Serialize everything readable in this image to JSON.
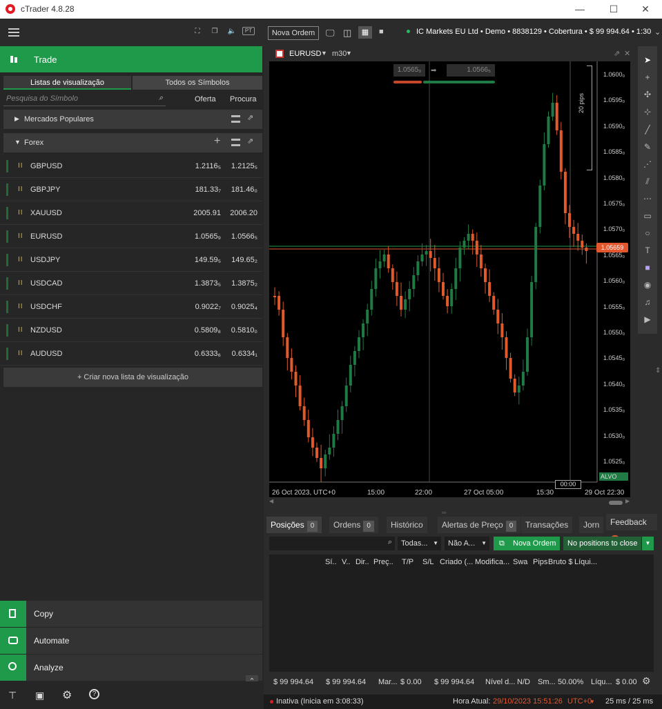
{
  "window": {
    "title": "cTrader 4.8.28",
    "min": "—",
    "max": "☐",
    "close": "✕"
  },
  "left": {
    "trade_label": "Trade",
    "tabs": [
      "Listas de visualização",
      "Todos os Símbolos"
    ],
    "search_placeholder": "Pesquisa do Símbolo",
    "col_bid": "Oferta",
    "col_ask": "Procura",
    "sections": [
      "Mercados Populares",
      "Forex"
    ],
    "symbols": [
      {
        "sym": "GBPUSD",
        "bid": "1.2116₅",
        "ask": "1.2125₅"
      },
      {
        "sym": "GBPJPY",
        "bid": "181.33₇",
        "ask": "181.46₀"
      },
      {
        "sym": "XAUUSD",
        "bid": "2005.91",
        "ask": "2006.20"
      },
      {
        "sym": "EURUSD",
        "bid": "1.0565₉",
        "ask": "1.0566₅"
      },
      {
        "sym": "USDJPY",
        "bid": "149.59₅",
        "ask": "149.65₂"
      },
      {
        "sym": "USDCAD",
        "bid": "1.3873₅",
        "ask": "1.3875₂"
      },
      {
        "sym": "USDCHF",
        "bid": "0.9022₇",
        "ask": "0.9025₄"
      },
      {
        "sym": "NZDUSD",
        "bid": "0.5809₈",
        "ask": "0.5810₀"
      },
      {
        "sym": "AUDUSD",
        "bid": "0.6333₆",
        "ask": "0.6334₁"
      }
    ],
    "new_list": "+ Criar nova lista de visualização",
    "nav": [
      "Copy",
      "Automate",
      "Analyze"
    ]
  },
  "right": {
    "new_order": "Nova Ordem",
    "account": "IC Markets EU Ltd • Demo • 8838129 • Cobertura • $ 99 994.64 • 1:30",
    "chart_symbol": "EURUSD",
    "timeframe": "m30",
    "sell_price": "1.0565₉",
    "buy_price": "1.0566₅",
    "pips_label": "20 pips",
    "price_tag": "1.05659",
    "target": "ALVO",
    "timer": "00:00",
    "y_ticks": [
      "1.0600₀",
      "1.0595₀",
      "1.0590₀",
      "1.0585₀",
      "1.0580₀",
      "1.0575₀",
      "1.0570₀",
      "1.0565₀",
      "1.0560₀",
      "1.0555₀",
      "1.0550₀",
      "1.0545₀",
      "1.0540₀",
      "1.0535₀",
      "1.0530₀",
      "1.0525₀"
    ],
    "x_ticks": [
      "26 Oct 2023, UTC+0",
      "15:00",
      "22:00",
      "27 Oct 05:00",
      "15:30",
      "29 Oct 22:30"
    ],
    "tabs": [
      {
        "label": "Posições",
        "count": "0"
      },
      {
        "label": "Ordens",
        "count": "0"
      },
      {
        "label": "Histórico",
        "count": ""
      },
      {
        "label": "Alertas de Preço",
        "count": "0"
      },
      {
        "label": "Transações",
        "count": ""
      },
      {
        "label": "Jorn",
        "count": ""
      }
    ],
    "feedback": "Feedback",
    "filter_all": "Todas...",
    "filter_na": "Não A...",
    "nova_ordem": "Nova Ordem",
    "no_positions": "No positions to close",
    "grid_cols": [
      "Sí..",
      "V..",
      "Dir..",
      "Preç..",
      "T/P",
      "S/L",
      "Criado (...",
      "Modifica...",
      "Swa",
      "Pips",
      "Bruto $",
      "Líqui..."
    ],
    "footer": [
      "$ 99 994.64",
      "$ 99 994.64",
      "Mar...",
      "$ 0.00",
      "$ 99 994.64",
      "Nível d...",
      "N/D",
      "Sm...",
      "50.00%",
      "Líqu...",
      "$ 0.00"
    ],
    "status": {
      "state": "Inativa (Inicia em 3:08:33)",
      "time_label": "Hora Atual:",
      "time": "29/10/2023 15:51:26",
      "tz": "UTC+0",
      "latency": "25 ms / 25 ms"
    }
  },
  "colors": {
    "green": "#1f9a4b",
    "red": "#e4572e",
    "up": "#1f7a44",
    "down": "#e05a2b"
  }
}
